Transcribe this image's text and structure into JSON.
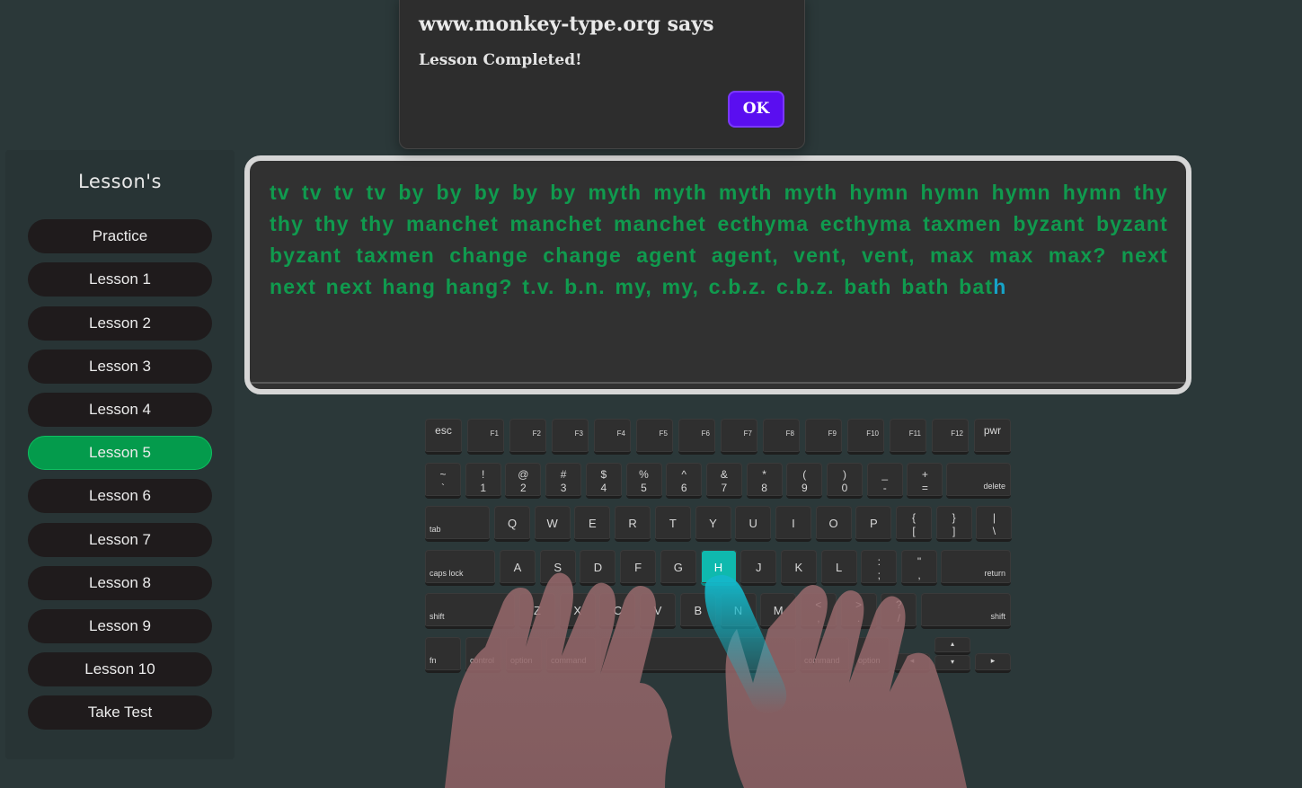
{
  "sidebar": {
    "title": "Lesson's",
    "items": [
      {
        "label": "Practice"
      },
      {
        "label": "Lesson 1"
      },
      {
        "label": "Lesson 2"
      },
      {
        "label": "Lesson 3"
      },
      {
        "label": "Lesson 4"
      },
      {
        "label": "Lesson 5"
      },
      {
        "label": "Lesson 6"
      },
      {
        "label": "Lesson 7"
      },
      {
        "label": "Lesson 8"
      },
      {
        "label": "Lesson 9"
      },
      {
        "label": "Lesson 10"
      },
      {
        "label": "Take Test"
      }
    ],
    "active_item": "Lesson 5"
  },
  "typing": {
    "typed_text": "tv tv tv tv by by by by by myth myth myth myth hymn hymn hymn hymn thy thy thy thy manchet manchet manchet ecthyma ecthyma taxmen byzant byzant byzant taxmen change change agent agent, vent, vent, max max max? next next next hang hang? t.v. b.n. my, my, c.b.z. c.b.z. bath bath bat",
    "current_char": "h",
    "typed_color": "#109a4e",
    "current_color": "#16a3c7"
  },
  "keyboard": {
    "highlighted_key": "H",
    "highlight_color": "#0fb9ae",
    "rows": {
      "function": [
        "esc",
        "F1",
        "F2",
        "F3",
        "F4",
        "F5",
        "F6",
        "F7",
        "F8",
        "F9",
        "F10",
        "F11",
        "F12",
        "pwr"
      ],
      "number": [
        {
          "top": "~",
          "bot": "`"
        },
        {
          "top": "!",
          "bot": "1"
        },
        {
          "top": "@",
          "bot": "2"
        },
        {
          "top": "#",
          "bot": "3"
        },
        {
          "top": "$",
          "bot": "4"
        },
        {
          "top": "%",
          "bot": "5"
        },
        {
          "top": "^",
          "bot": "6"
        },
        {
          "top": "&",
          "bot": "7"
        },
        {
          "top": "*",
          "bot": "8"
        },
        {
          "top": "(",
          "bot": "9"
        },
        {
          "top": ")",
          "bot": "0"
        },
        {
          "top": "_",
          "bot": "-"
        },
        {
          "top": "+",
          "bot": "="
        }
      ],
      "delete": "delete",
      "tab": "tab",
      "qwerty": [
        "Q",
        "W",
        "E",
        "R",
        "T",
        "Y",
        "U",
        "I",
        "O",
        "P"
      ],
      "qwerty_sym": [
        {
          "top": "{",
          "bot": "["
        },
        {
          "top": "}",
          "bot": "]"
        },
        {
          "top": "|",
          "bot": "\\"
        }
      ],
      "caps": "caps lock",
      "home": [
        "A",
        "S",
        "D",
        "F",
        "G",
        "H",
        "J",
        "K",
        "L"
      ],
      "home_sym": [
        {
          "top": ":",
          "bot": ";"
        },
        {
          "top": "\"",
          "bot": ","
        }
      ],
      "return": "return",
      "shift": "shift",
      "bottom_letters": [
        "Z",
        "X",
        "C",
        "V",
        "B",
        "N",
        "M"
      ],
      "bottom_sym": [
        {
          "top": "<",
          "bot": ","
        },
        {
          "top": ">",
          "bot": "."
        },
        {
          "top": "?",
          "bot": "/"
        }
      ],
      "fn": "fn",
      "control": "control",
      "option": "option",
      "command": "command",
      "arrows": [
        "◂",
        "▴",
        "▾",
        "▸"
      ]
    }
  },
  "dialog": {
    "title": "www.monkey-type.org says",
    "message": "Lesson Completed!",
    "ok_label": "OK"
  }
}
